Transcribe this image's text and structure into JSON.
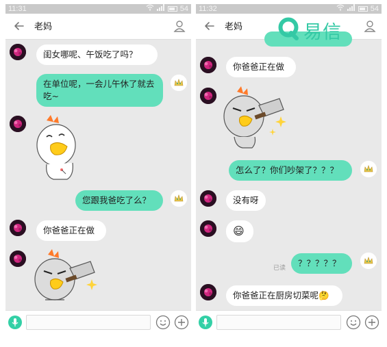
{
  "watermark": {
    "text": "易信",
    "color": "#34c9a5"
  },
  "colors": {
    "accent": "#62dfbb",
    "bg": "#e9e9e9",
    "statusbar": "#c9c9c9"
  },
  "screens": [
    {
      "status": {
        "time": "11:31",
        "battery": "54"
      },
      "header": {
        "title": "老妈"
      },
      "messages": [
        {
          "from": "contact",
          "text": "闺女哪呢、午饭吃了吗？"
        },
        {
          "from": "me",
          "text": "在单位呢，一会儿午休了就去吃~"
        },
        {
          "from": "contact",
          "sticker": "chicken-smile"
        },
        {
          "from": "me",
          "text": "您跟我爸吃了么？"
        },
        {
          "from": "contact",
          "text": "你爸爸正在做"
        },
        {
          "from": "contact",
          "sticker": "chicken-cleaver"
        }
      ]
    },
    {
      "status": {
        "time": "11:32",
        "battery": "54"
      },
      "header": {
        "title": "老妈"
      },
      "messages": [
        {
          "from": "contact",
          "text": "你爸爸正在做"
        },
        {
          "from": "contact",
          "sticker": "chicken-cleaver"
        },
        {
          "from": "me",
          "text": "怎么了？你们吵架了？？？"
        },
        {
          "from": "contact",
          "text": "没有呀"
        },
        {
          "from": "contact",
          "emoji": "😄"
        },
        {
          "from": "me",
          "text": "？？？？？",
          "read_label": "已读"
        },
        {
          "from": "contact",
          "text": "你爸爸正在厨房切菜呢",
          "trailing_emoji": "🤔"
        }
      ]
    }
  ]
}
